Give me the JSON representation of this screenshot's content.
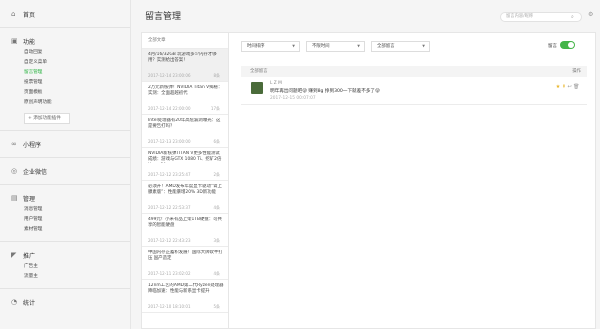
{
  "sidebar": {
    "home": "首页",
    "func": {
      "title": "功能",
      "items": [
        "自动回复",
        "自定义菜单",
        "留言管理",
        "投票管理",
        "页面模板",
        "原创声明功能"
      ],
      "active_index": 2,
      "add_button": "+ 添加功能插件"
    },
    "mini": "小程序",
    "wecom": "企业微信",
    "manage": {
      "title": "管理",
      "items": [
        "消息管理",
        "用户管理",
        "素材管理"
      ]
    },
    "promo": {
      "title": "推广",
      "items": [
        "广告主",
        "流量主"
      ]
    },
    "stats": "统计"
  },
  "header": {
    "title": "留言管理",
    "search_placeholder": "留言内容/昵称"
  },
  "list": {
    "header": "全部文章",
    "items": [
      {
        "title": "4月/16/32GB 玩游戏多少内存才够用？实测给出答案！",
        "meta": "2017-12-14 23:00:06",
        "count": "8条"
      },
      {
        "title": "2万元新核弹！NVIDIA Titan V揭秘：实测：全面超越初代",
        "meta": "2017-12-14 22:00:00",
        "count": "17条"
      },
      {
        "title": "Intel处理器有20年高危漏洞曝光：这是要告打吗？",
        "meta": "2017-12-13 23:00:00",
        "count": "6条"
      },
      {
        "title": "NVIDIA新核弹TITAN V更多性能测试成绩：游戏与GTX 1080 Ti、挖矿2倍Vega 64",
        "meta": "2017-12-12 23:25:47",
        "count": "2条"
      },
      {
        "title": "必须升！AMD发布年度显卡驱动“肾上腺素版”：性能暴增20% 3D新功能",
        "meta": "2017-12-12 22:53:37",
        "count": "4条"
      },
      {
        "title": "499元！小米有品上架1TB硬盘：可共享的智能硬盘",
        "meta": "2017-12-12 22:43:23",
        "count": "3条"
      },
      {
        "title": "中国内存正蓄积发展！国际大牌砍半打压 国产造定",
        "meta": "2017-12-11 23:02:02",
        "count": "4条"
      },
      {
        "title": "12nm工艺的AMD第二代Ryzen处理器降临加速：性能与新系显卡提升",
        "meta": "2017-12-10 18:10:01",
        "count": "5条"
      }
    ],
    "selected_index": 0
  },
  "filters": {
    "time": "时间排序",
    "status": "不限时间",
    "type": "全部留言",
    "toggle_label": "留言",
    "toggle_on": true
  },
  "table": {
    "col_left": "全部留言",
    "col_right": "操作"
  },
  "comment": {
    "user": "L Z M",
    "content": "明年再出问题吧😜 赚到8g 挣到300一下就差不多了😜",
    "time": "2017-12-15 00:07:07"
  },
  "colors": {
    "accent": "#44b549"
  }
}
